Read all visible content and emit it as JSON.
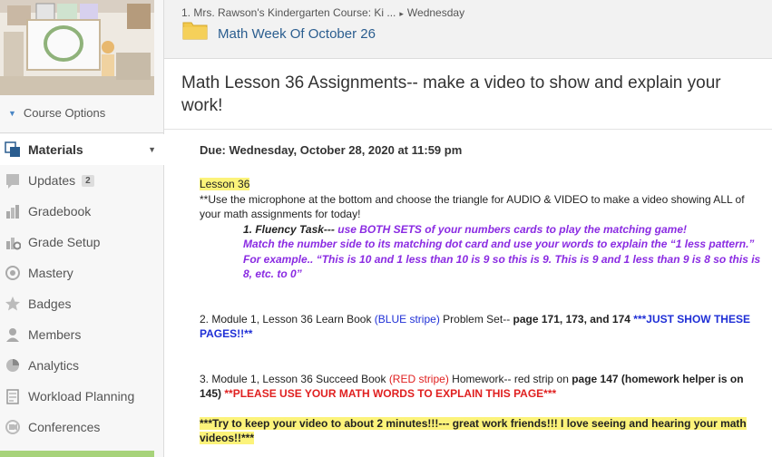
{
  "sidebar": {
    "course_options": "Course Options",
    "items": [
      {
        "label": "Materials",
        "icon": "materials-icon"
      },
      {
        "label": "Updates",
        "icon": "updates-icon",
        "badge": "2"
      },
      {
        "label": "Gradebook",
        "icon": "gradebook-icon"
      },
      {
        "label": "Grade Setup",
        "icon": "grade-setup-icon"
      },
      {
        "label": "Mastery",
        "icon": "mastery-icon"
      },
      {
        "label": "Badges",
        "icon": "badges-icon"
      },
      {
        "label": "Members",
        "icon": "members-icon"
      },
      {
        "label": "Analytics",
        "icon": "analytics-icon"
      },
      {
        "label": "Workload Planning",
        "icon": "workload-icon"
      },
      {
        "label": "Conferences",
        "icon": "conferences-icon"
      }
    ]
  },
  "header": {
    "breadcrumb_course": "1. Mrs. Rawson's Kindergarten Course: Ki ...",
    "breadcrumb_folder": "Wednesday",
    "folder_title": "Math Week Of October 26"
  },
  "assignment": {
    "title": "Math Lesson 36 Assignments-- make a video to show and explain your work!",
    "due_label": "Due:",
    "due_value": "Wednesday, October 28, 2020 at 11:59 pm"
  },
  "content": {
    "lesson": "Lesson 36",
    "intro": "**Use the microphone at the bottom and choose the triangle for AUDIO & VIDEO to make a video showing ALL of your math assignments for today!",
    "task1_label": "1.  Fluency Task---",
    "task1_text": " use BOTH SETS of your numbers cards to play the matching game!",
    "task1_line2": "Match the number side to its matching dot card and use your words to explain the “1 less pattern.”",
    "task1_line3": "For example.. “This is 10 and 1 less than 10 is 9 so this is 9.  This is 9 and 1 less than 9 is 8 so this is 8, etc. to 0”",
    "item2_a": "2.  Module 1, Lesson 36 Learn Book ",
    "item2_blue": "(BLUE stripe)",
    "item2_b": " Problem Set-- ",
    "item2_pages": "page 171, 173, and 174",
    "item2_blue2": "  ***JUST SHOW THESE PAGES!!**",
    "item3_a": "3. Module 1, Lesson 36 Succeed Book ",
    "item3_red": "(RED stripe)",
    "item3_b": " Homework-- red strip on ",
    "item3_pages": "page 147 (homework helper is on 145)",
    "item3_red2": " **PLEASE USE YOUR MATH WORDS TO EXPLAIN THIS PAGE***",
    "closing": "***Try to keep your video to about 2 minutes!!!--- great work friends!!!  I love seeing and hearing your math videos!!***"
  },
  "colors": {
    "accent_blue": "#2a5d8f",
    "highlight_yellow": "#fcf37a",
    "purple": "#8a2be2",
    "blue_text": "#1f2fd6",
    "red_text": "#e02020",
    "sidebar_green": "#a7d37a"
  }
}
